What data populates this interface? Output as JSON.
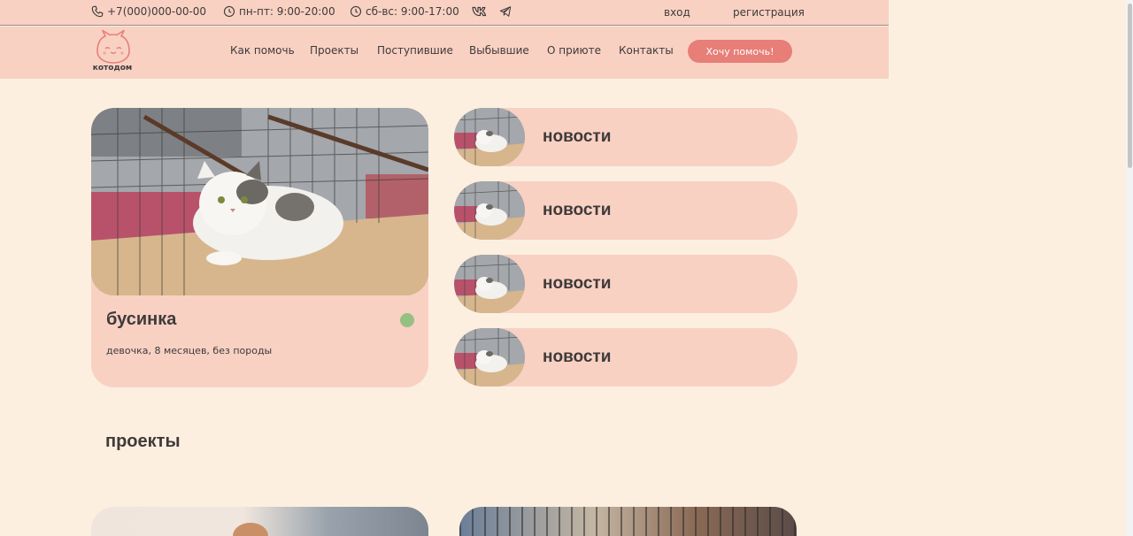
{
  "topbar": {
    "phone": "+7(000)000-00-00",
    "hours_weekdays": "пн-пт: 9:00-20:00",
    "hours_weekend": "сб-вс: 9:00-17:00",
    "login": "вход",
    "register": "регистрация"
  },
  "nav": {
    "logo_text": "котодом",
    "items": [
      "Как помочь",
      "Проекты",
      "Поступившие",
      "Выбывшие",
      "О приюте",
      "Контакты"
    ],
    "cta": "Хочу помочь!"
  },
  "featured_cat": {
    "name": "бусинка",
    "description": "девочка, 8 месяцев, без породы",
    "status_color": "#95c082"
  },
  "news": [
    {
      "title": "новости"
    },
    {
      "title": "новости"
    },
    {
      "title": "новости"
    },
    {
      "title": "новости"
    }
  ],
  "projects": {
    "title": "проекты"
  },
  "colors": {
    "background": "#fcefe0",
    "header": "#f8d1c3",
    "accent": "#e77e77",
    "text": "#3f3a3a"
  }
}
